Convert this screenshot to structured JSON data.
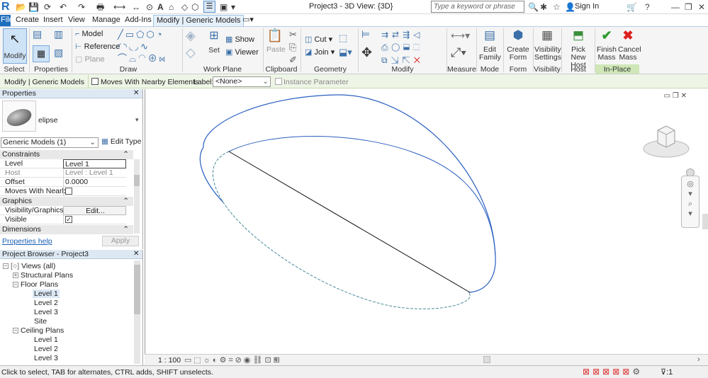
{
  "app": {
    "logo": "R",
    "title": "Project3 - 3D View: {3D}",
    "search_placeholder": "Type a keyword or phrase",
    "sign_in": "Sign In"
  },
  "tabs": [
    "File",
    "Create",
    "Insert",
    "View",
    "Manage",
    "Add-Ins",
    "Modify | Generic Models"
  ],
  "ribbon": {
    "select": {
      "modify": "Modify",
      "label": "Select"
    },
    "properties_label": "Properties",
    "draw": {
      "model": "Model",
      "reference": "Reference",
      "plane": "Plane",
      "label": "Draw"
    },
    "work_plane": {
      "show": "Show",
      "set": "Set",
      "viewer": "Viewer",
      "label": "Work Plane"
    },
    "clipboard": {
      "paste": "Paste",
      "label": "Clipboard"
    },
    "geometry": {
      "cut": "Cut",
      "join": "Join",
      "label": "Geometry"
    },
    "modify_label": "Modify",
    "measure_label": "Measure",
    "mode": {
      "edit_family_1": "Edit",
      "edit_family_2": "Family",
      "label": "Mode"
    },
    "form": {
      "create_1": "Create",
      "create_2": "Form",
      "label": "Form"
    },
    "visibility": {
      "v1": "Visibility",
      "v2": "Settings",
      "label": "Visibility"
    },
    "host": {
      "h1": "Pick",
      "h2": "New Host",
      "label": "Host"
    },
    "inplace": {
      "finish1": "Finish",
      "finish2": "Mass",
      "cancel1": "Cancel",
      "cancel2": "Mass",
      "label": "In-Place Editor"
    }
  },
  "options_bar": {
    "context": "Modify | Generic Models",
    "moves": "Moves With Nearby Elements",
    "label": "Label:",
    "label_value": "<None>",
    "instance": "Instance Parameter"
  },
  "properties": {
    "title": "Properties",
    "type_name": "elipse",
    "selector": "Generic Models (1)",
    "edit_type": "Edit Type",
    "sections": {
      "constraints": "Constraints",
      "graphics": "Graphics",
      "dimensions": "Dimensions"
    },
    "rows": {
      "level_k": "Level",
      "level_v": "Level 1",
      "host_k": "Host",
      "host_v": "Level : Level 1",
      "offset_k": "Offset",
      "offset_v": "0.0000",
      "moves_k": "Moves With Nearb...",
      "vis_k": "Visibility/Graphics ...",
      "vis_v": "Edit...",
      "visible_k": "Visible"
    },
    "help": "Properties help",
    "apply": "Apply"
  },
  "browser": {
    "title": "Project Browser - Project3",
    "views": "Views (all)",
    "structural": "Structural Plans",
    "floor": "Floor Plans",
    "floor_items": [
      "Level 1",
      "Level 2",
      "Level 3",
      "Site"
    ],
    "ceiling": "Ceiling Plans",
    "ceiling_items": [
      "Level 1",
      "Level 2",
      "Level 3"
    ]
  },
  "view_control": {
    "scale": "1 : 100"
  },
  "status": {
    "text": "Click to select, TAB for alternates, CTRL adds, SHIFT unselects.",
    "filter": ":1"
  }
}
